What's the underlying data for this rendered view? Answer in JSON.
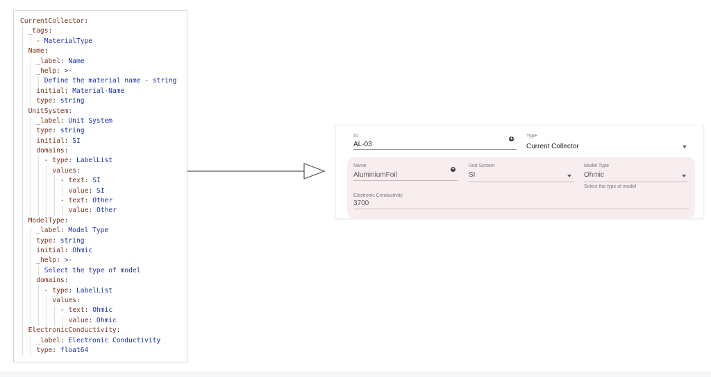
{
  "yaml_lines": [
    {
      "indent": 0,
      "key": "CurrentCollector",
      "value": ""
    },
    {
      "indent": 1,
      "key": "_tags",
      "value": ""
    },
    {
      "indent": 2,
      "dash": true,
      "key": "",
      "value": "MaterialType"
    },
    {
      "indent": 1,
      "key": "Name",
      "value": ""
    },
    {
      "indent": 2,
      "key": "_label",
      "value": "Name"
    },
    {
      "indent": 2,
      "key": "_help",
      "value": ">-"
    },
    {
      "indent": 3,
      "key": "",
      "value": "Define the material name - string"
    },
    {
      "indent": 2,
      "key": "initial",
      "value": "Material-Name"
    },
    {
      "indent": 2,
      "key": "type",
      "value": "string"
    },
    {
      "indent": 1,
      "key": "UnitSystem",
      "value": ""
    },
    {
      "indent": 2,
      "key": "_label",
      "value": "Unit System"
    },
    {
      "indent": 2,
      "key": "type",
      "value": "string"
    },
    {
      "indent": 2,
      "key": "initial",
      "value": "SI"
    },
    {
      "indent": 2,
      "key": "domains",
      "value": ""
    },
    {
      "indent": 3,
      "dash": true,
      "key": "type",
      "value": "LabelList"
    },
    {
      "indent": 4,
      "key": "values",
      "value": ""
    },
    {
      "indent": 5,
      "dash": true,
      "key": "text",
      "value": "SI"
    },
    {
      "indent": 6,
      "key": "value",
      "value": "SI"
    },
    {
      "indent": 5,
      "dash": true,
      "key": "text",
      "value": "Other"
    },
    {
      "indent": 6,
      "key": "value",
      "value": "Other"
    },
    {
      "indent": 1,
      "key": "ModelType",
      "value": ""
    },
    {
      "indent": 2,
      "key": "_label",
      "value": "Model Type"
    },
    {
      "indent": 2,
      "key": "type",
      "value": "string"
    },
    {
      "indent": 2,
      "key": "initial",
      "value": "Ohmic"
    },
    {
      "indent": 2,
      "key": "_help",
      "value": ">-"
    },
    {
      "indent": 3,
      "key": "",
      "value": "Select the type of model"
    },
    {
      "indent": 2,
      "key": "domains",
      "value": ""
    },
    {
      "indent": 3,
      "dash": true,
      "key": "type",
      "value": "LabelList"
    },
    {
      "indent": 4,
      "key": "values",
      "value": ""
    },
    {
      "indent": 5,
      "dash": true,
      "key": "text",
      "value": "Ohmic"
    },
    {
      "indent": 6,
      "key": "value",
      "value": "Ohmic"
    },
    {
      "indent": 1,
      "key": "ElectronicConductivity",
      "value": ""
    },
    {
      "indent": 2,
      "key": "_label",
      "value": "Electronic Conductivity"
    },
    {
      "indent": 2,
      "key": "type",
      "value": "float64"
    }
  ],
  "form": {
    "id_label": "ID",
    "id_value": "AL-03",
    "type_label": "Type",
    "type_value": "Current Collector",
    "name_label": "Name",
    "name_value": "AluminiumFoil",
    "unit_system_label": "Unit System",
    "unit_system_value": "SI",
    "model_type_label": "Model Type",
    "model_type_value": "Ohmic",
    "model_type_help": "Select the type of model",
    "conductivity_label": "Electronic Conductivity",
    "conductivity_value": "3700"
  },
  "icons": {
    "id_action": "plus-circle-icon",
    "name_action": "plus-circle-icon",
    "dropdown": "chevron-down-icon",
    "arrow": "right-arrow-icon"
  },
  "colors": {
    "yaml_key": "#7a2f1e",
    "yaml_value": "#1a2fb0",
    "subpanel_bg": "#f8eeef"
  }
}
